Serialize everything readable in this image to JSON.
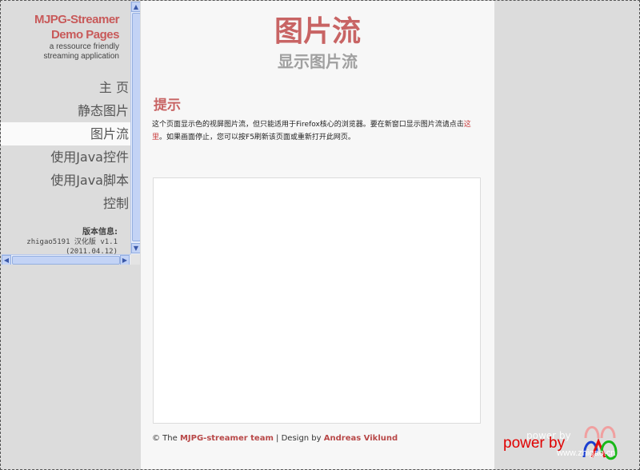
{
  "nav": {
    "brand_line1": "MJPG-Streamer",
    "brand_line2": "Demo Pages",
    "brand_sub1": "a ressource friendly",
    "brand_sub2": "streaming application",
    "items": [
      {
        "label": "主 页"
      },
      {
        "label": "静态图片"
      },
      {
        "label": "图片流"
      },
      {
        "label": "使用Java控件"
      },
      {
        "label": "使用Java脚本"
      },
      {
        "label": "控制"
      }
    ],
    "active_index": 2,
    "version_title": "版本信息:",
    "version_line1": "zhigao5191 汉化版 v1.1",
    "version_line2": "(2011.04.12)"
  },
  "main": {
    "title": "图片流",
    "subtitle": "显示图片流",
    "notice_heading": "提示",
    "notice_text1": "这个页面显示色的视屏图片流，但只能适用于Firefox核心的浏览器。要在新窗口显示图片流请点击",
    "notice_link": "这里",
    "notice_text2": "。如果画面停止，您可以按F5刷新该页面或重新打开此网页。"
  },
  "footer": {
    "copy": "© The",
    "team": "MJPG-streamer team",
    "sep": " | Design by",
    "designer": "Andreas Viklund"
  },
  "watermark": {
    "ghost": "power by",
    "power": "power by",
    "url": "www.zhigao.cn"
  },
  "colors": {
    "accent": "#c86464",
    "nav_bg": "#dcdcdc",
    "content_bg": "#f7f7f7"
  }
}
